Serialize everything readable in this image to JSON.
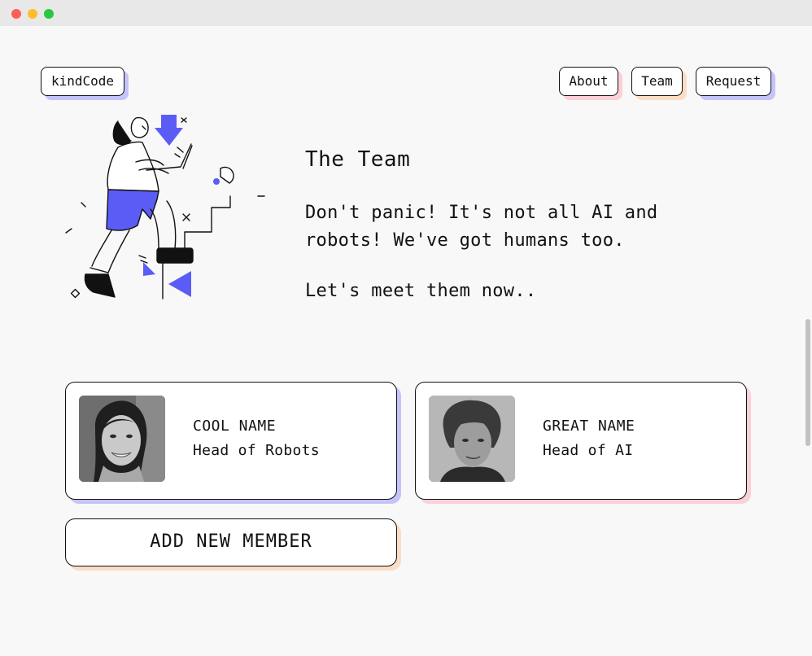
{
  "nav": {
    "logo": "kindCode",
    "links": [
      {
        "label": "About"
      },
      {
        "label": "Team"
      },
      {
        "label": "Request"
      }
    ]
  },
  "hero": {
    "title": "The Team",
    "intro": "Don't panic! It's not all AI and robots! We've got humans too.",
    "outro": "Let's meet them now.."
  },
  "team": {
    "members": [
      {
        "name": "COOL NAME",
        "role": "Head of Robots"
      },
      {
        "name": "GREAT NAME",
        "role": "Head of AI"
      }
    ],
    "add_label": "ADD NEW MEMBER"
  },
  "colors": {
    "accent": "#5b5cf6",
    "shadow_blue": "#c4c4fb",
    "shadow_pink": "#fbd0d8",
    "shadow_peach": "#fbdcc4"
  }
}
